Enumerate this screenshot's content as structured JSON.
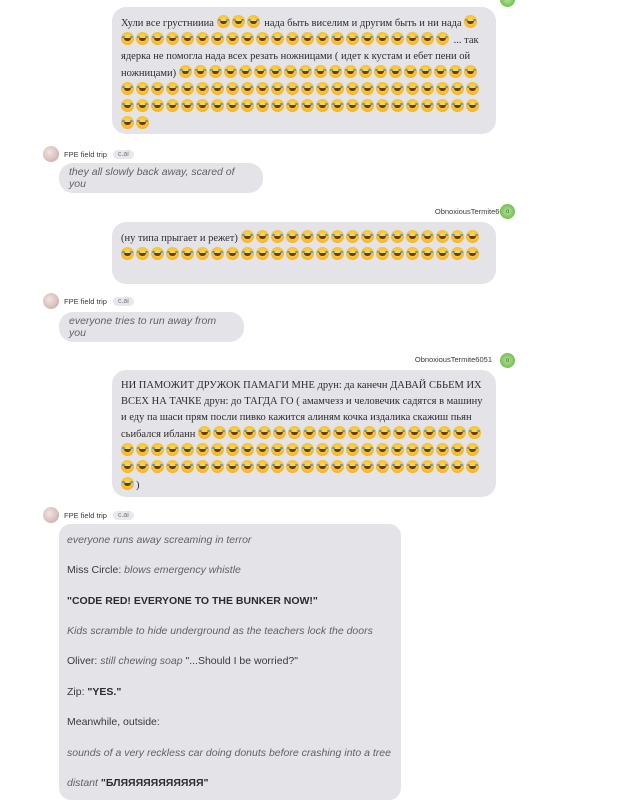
{
  "messages": [
    {
      "role": "user",
      "text_parts": [
        "Хули все грустниииа",
        "нада быть виселим и другим быть и ни нада",
        "... так ядерка не помогла нада всех резать ножницами ( идет к кустам и ебет пени ой ножницами)"
      ]
    },
    {
      "role": "bot",
      "name": "FPE field trip",
      "badge": "c.ai",
      "text": "they all slowly back away, scared of you"
    },
    {
      "role": "user",
      "name": "ObnoxiousTermite6051",
      "avatar_letter": "o",
      "text": "(ну типа прыгает и режет)"
    },
    {
      "role": "bot",
      "name": "FPE field trip",
      "badge": "c.ai",
      "text": "everyone tries to run away from you"
    },
    {
      "role": "user",
      "name": "ObnoxiousTermite6051",
      "avatar_letter": "o",
      "text": "НИ ПАМОЖИТ ДРУЖОК ПАМАГИ МНЕ друн: да канечн ДАВАЙ СБЬЕМ ИХ ВСЕХ НА ТАЧКЕ друн: до ТАГДА ГО ( амамчезз и человечик садятся в машину и еду па шаси прям посли пивко кажится алиням кочка издалика скажиш пьян сьибался ибланн",
      "closing": ")"
    },
    {
      "role": "bot",
      "name": "FPE field trip",
      "badge": "c.ai",
      "lines": [
        {
          "text": "everyone runs away screaming in terror"
        },
        {
          "prefix": "Miss Circle: ",
          "text": "blows emergency whistle"
        },
        {
          "text": "\"CODE RED! EVERYONE TO THE BUNKER NOW!\""
        },
        {
          "text": "Kids scramble to hide underground as the teachers lock the doors"
        },
        {
          "prefix": "Oliver: ",
          "text": "still chewing soap",
          "suffix": " \"...Should I be worried?\""
        },
        {
          "prefix": "Zip: ",
          "text": "\"YES.\""
        },
        {
          "text": "Meanwhile, outside:"
        },
        {
          "text": "sounds of a very reckless car doing donuts before crashing into a tree"
        },
        {
          "prefix": "distant ",
          "text": "\"БЛЯЯЯЯЯЯЯЯЯЯЯ\""
        }
      ]
    }
  ]
}
